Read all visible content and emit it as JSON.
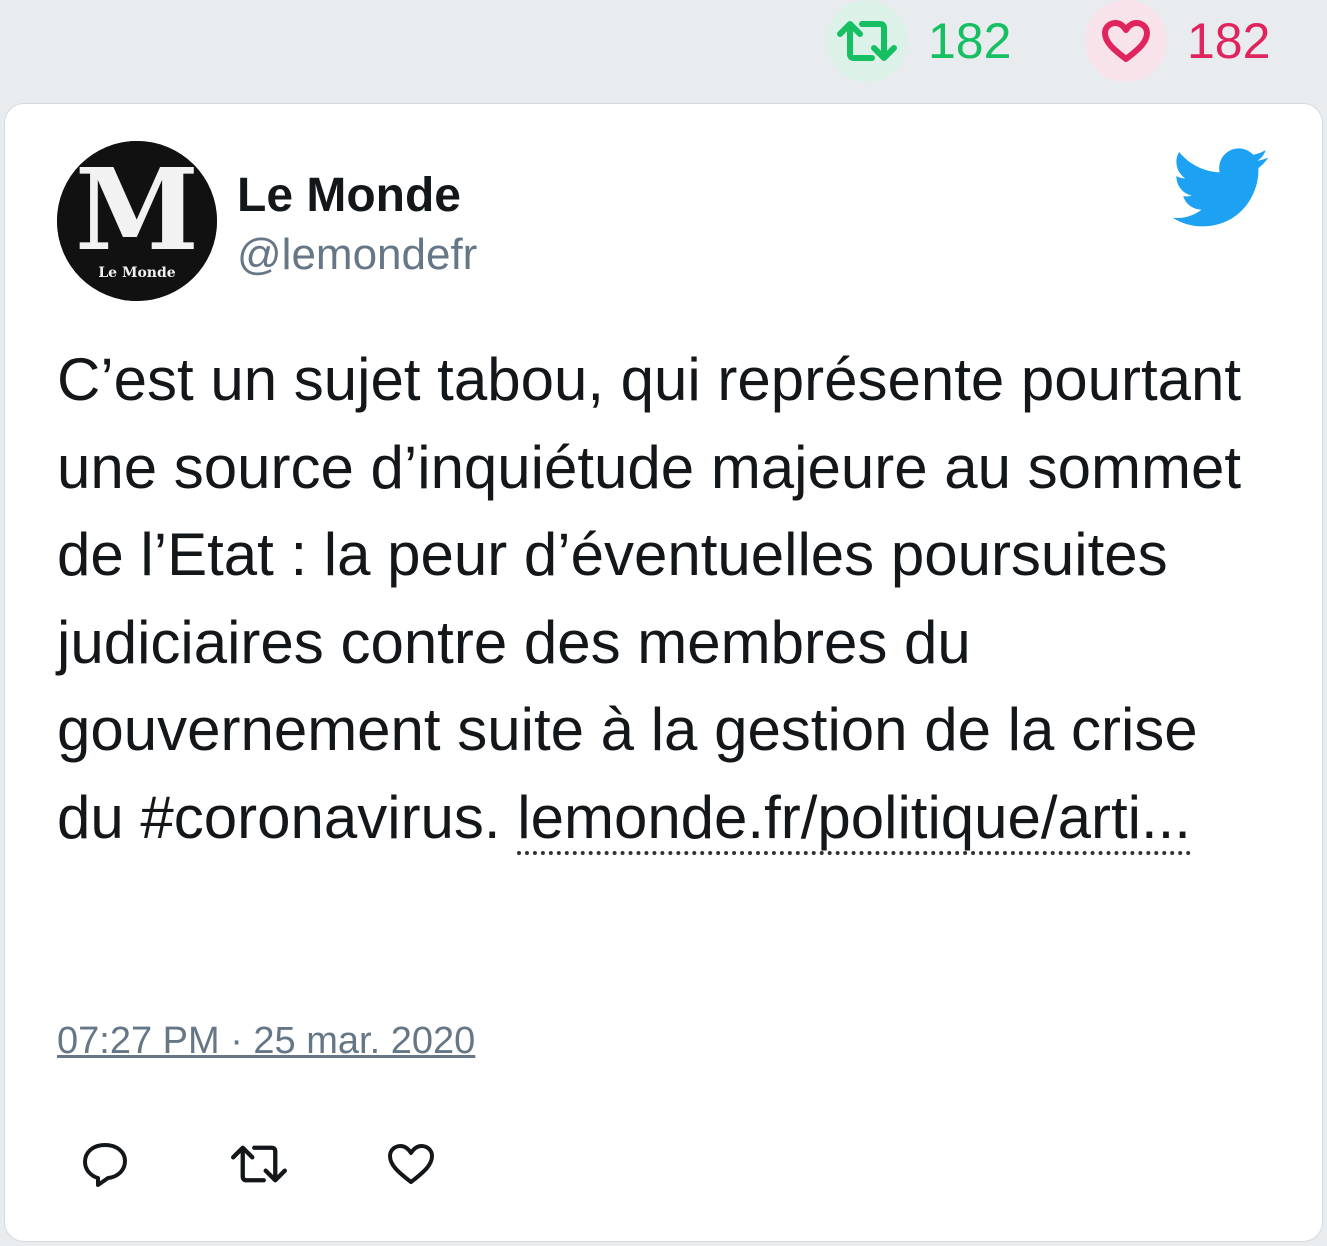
{
  "header_stats": {
    "retweets": "182",
    "likes": "182"
  },
  "tweet": {
    "author_name": "Le Monde",
    "author_handle": "@lemondefr",
    "avatar_letter": "M",
    "avatar_caption": "Le Monde",
    "text": "C’est un sujet tabou, qui représente pourtant une source d’inquiétude majeure au sommet de l’Etat : la peur d’éventuelles poursuites judiciaires contre des membres du gouvernement suite à la gestion de la crise du #coronavirus.",
    "link_text": "lemonde.fr/politique/arti...",
    "timestamp": "07:27 PM · 25 mar. 2020"
  },
  "icons": {
    "retweet_stat": "retweet-icon",
    "like_stat": "heart-icon",
    "brand": "twitter-bird-icon",
    "reply_action": "reply-icon",
    "retweet_action": "retweet-icon",
    "like_action": "heart-icon"
  },
  "colors": {
    "retweet": "#17bf63",
    "like": "#e0245e",
    "twitter_blue": "#1da1f2",
    "secondary_text": "#657786"
  }
}
